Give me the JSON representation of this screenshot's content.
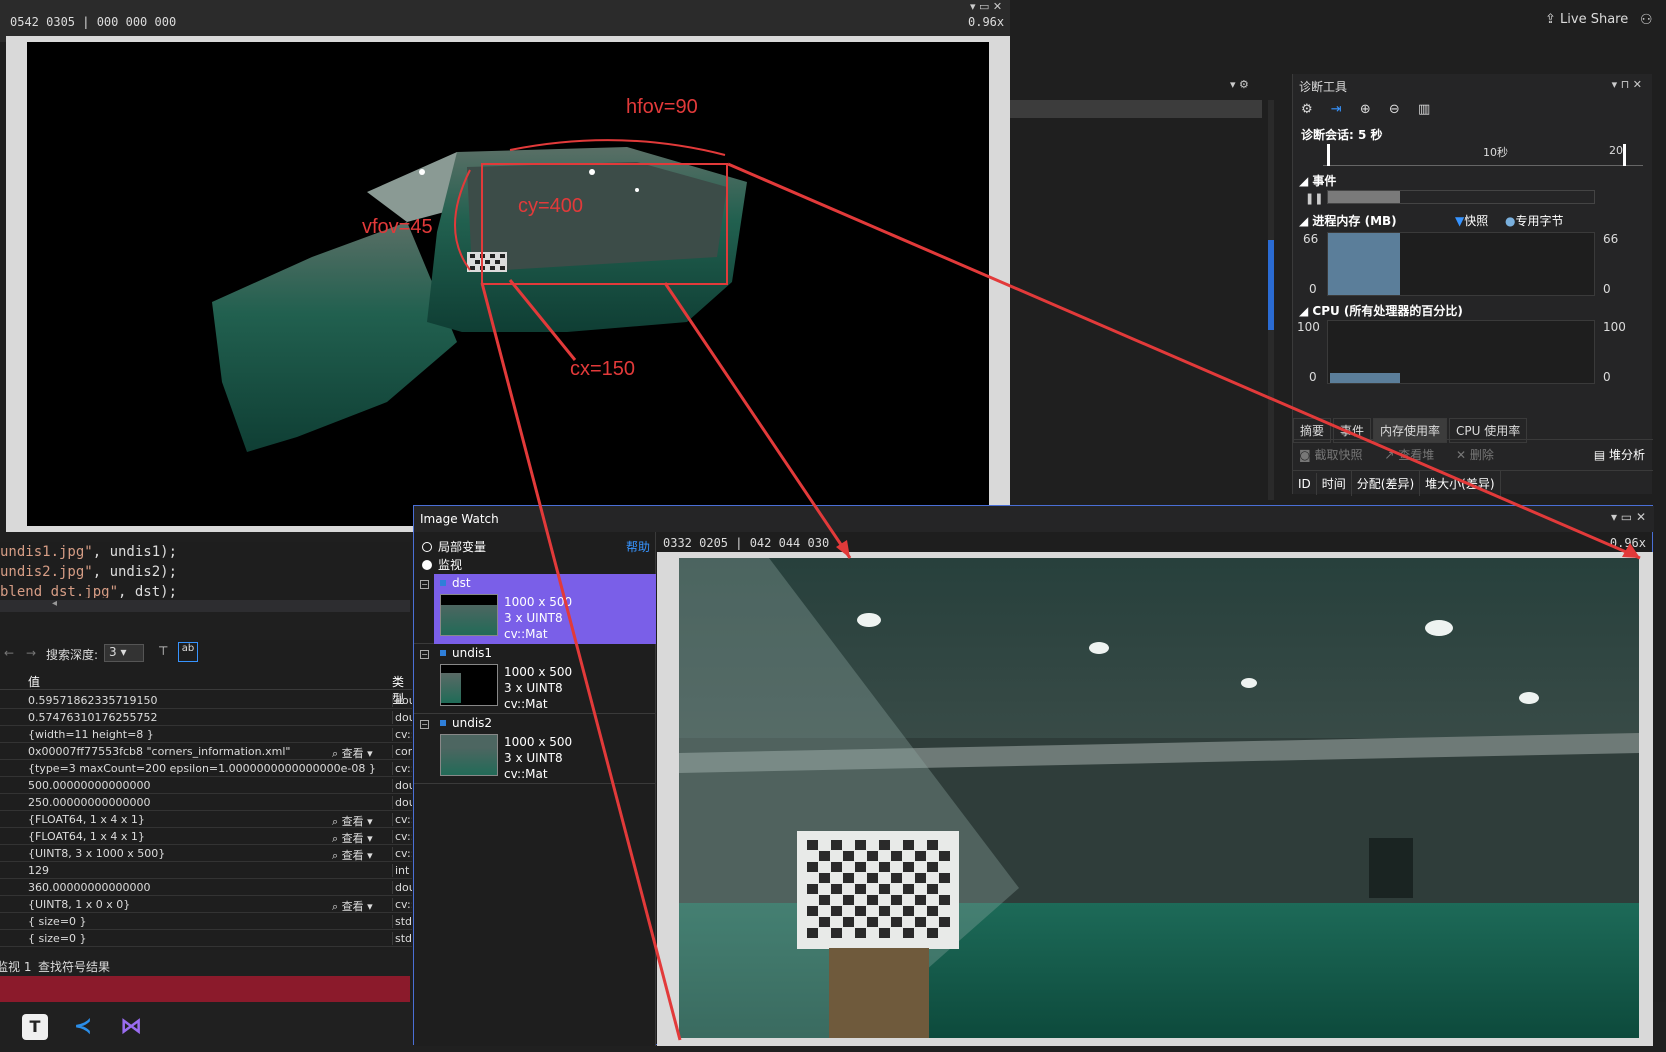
{
  "top_strip": {
    "coords": "0542 0305 | 000 000 000",
    "zoom": "0.96x"
  },
  "live_share": "Live Share",
  "annotations": {
    "hfov": "hfov=90",
    "vfov": "vfov=45",
    "cy": "cy=400",
    "cx": "cx=150"
  },
  "diag": {
    "title": "诊断工具",
    "session": "诊断会话: 5 秒",
    "timeline_labels": [
      "10秒",
      "20"
    ],
    "events_label": "事件",
    "memory_label": "进程内存 (MB)",
    "snapshot_label": "快照",
    "private_bytes_label": "专用字节",
    "mem_max_left": "66",
    "mem_min_left": "0",
    "mem_max_right": "66",
    "mem_min_right": "0",
    "cpu_label": "CPU (所有处理器的百分比)",
    "cpu_max_left": "100",
    "cpu_min_left": "0",
    "cpu_max_right": "100",
    "cpu_min_right": "0",
    "tabs": [
      "摘要",
      "事件",
      "内存使用率",
      "CPU 使用率"
    ],
    "actions": [
      "截取快照",
      "查看堆",
      "删除",
      "堆分析"
    ],
    "columns": [
      "ID",
      "时间",
      "分配(差异)",
      "堆大小(差异)"
    ]
  },
  "code": {
    "lines": [
      {
        "str": "undis1.jpg\"",
        "rest": ", undis1);"
      },
      {
        "str": "undis2.jpg\"",
        "rest": ", undis2);"
      },
      {
        "str": "blend_dst.jpg\"",
        "rest": ", dst);"
      }
    ]
  },
  "watch": {
    "depth_label": "搜索深度:",
    "depth_value": "3",
    "col_value": "值",
    "col_type": "类型",
    "look_label": "查看",
    "rows": [
      {
        "val": "0.59571862335719150",
        "look": "",
        "typ": "dou"
      },
      {
        "val": "0.57476310176255752",
        "look": "",
        "typ": "dou"
      },
      {
        "val": "{width=11 height=8 }",
        "look": "",
        "typ": "cv::"
      },
      {
        "val": "0x00007ff77553fcb8 \"corners_information.xml\"",
        "look": "查看",
        "typ": "con"
      },
      {
        "val": "{type=3 maxCount=200 epsilon=1.0000000000000000e-08 }",
        "look": "",
        "typ": "cv::"
      },
      {
        "val": "500.00000000000000",
        "look": "",
        "typ": "dou"
      },
      {
        "val": "250.00000000000000",
        "look": "",
        "typ": "dou"
      },
      {
        "val": "{FLOAT64, 1 x 4 x 1}",
        "look": "查看",
        "typ": "cv::l"
      },
      {
        "val": "{FLOAT64, 1 x 4 x 1}",
        "look": "查看",
        "typ": "cv::l"
      },
      {
        "val": "{UINT8, 3 x 1000 x 500}",
        "look": "查看",
        "typ": "cv::l"
      },
      {
        "val": "129",
        "look": "",
        "typ": "int"
      },
      {
        "val": "360.00000000000000",
        "look": "",
        "typ": "dou"
      },
      {
        "val": "{UINT8, 1 x 0 x 0}",
        "look": "查看",
        "typ": "cv::l"
      },
      {
        "val": "{ size=0 }",
        "look": "",
        "typ": "std:"
      },
      {
        "val": "{ size=0 }",
        "look": "",
        "typ": "std:"
      }
    ],
    "bottom_tabs": [
      "监视 1",
      "查找符号结果"
    ]
  },
  "image_watch": {
    "title": "Image Watch",
    "radio_locals": "局部变量",
    "radio_watch": "监视",
    "help": "帮助",
    "info": "0332 0205 | 042 044 030",
    "zoom": "0.96x",
    "items": [
      {
        "name": "dst",
        "size": "1000 x 500",
        "channels": "3 x UINT8",
        "type": "cv::Mat"
      },
      {
        "name": "undis1",
        "size": "1000 x 500",
        "channels": "3 x UINT8",
        "type": "cv::Mat"
      },
      {
        "name": "undis2",
        "size": "1000 x 500",
        "channels": "3 x UINT8",
        "type": "cv::Mat"
      }
    ]
  },
  "colors": {
    "accent_red": "#e23a3a",
    "selection": "#7a5fe8",
    "link_blue": "#3794ff"
  }
}
